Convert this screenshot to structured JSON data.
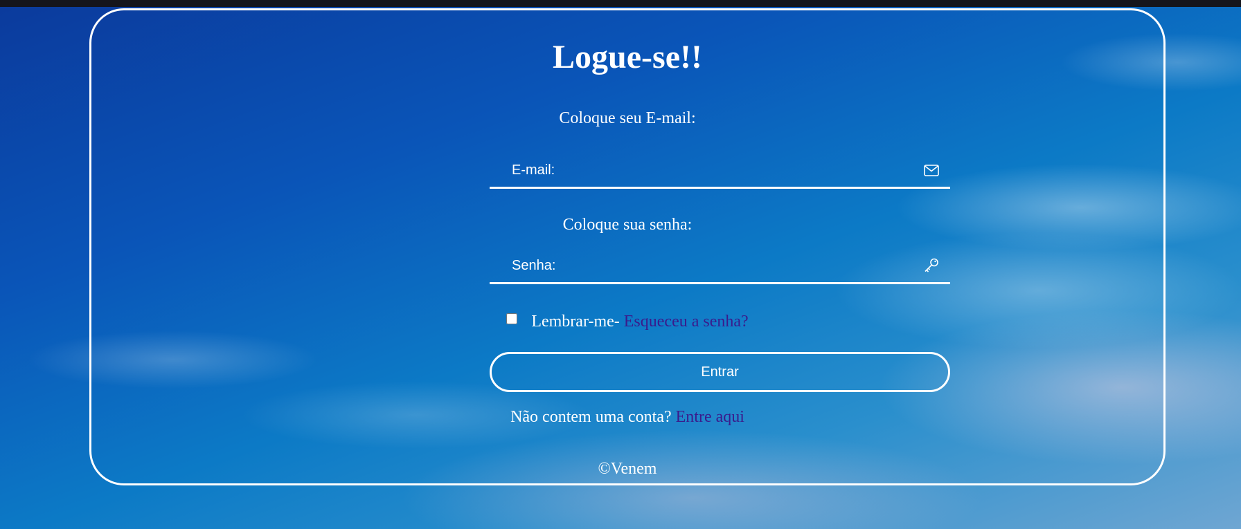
{
  "login": {
    "title": "Logue-se!!",
    "email_label": "Coloque seu E-mail:",
    "email_placeholder": "E-mail:",
    "email_value": "",
    "email_icon": "envelope-icon",
    "password_label": "Coloque sua senha:",
    "password_placeholder": "Senha:",
    "password_value": "",
    "password_icon": "key-icon",
    "remember_label": "Lembrar-me-",
    "remember_checked": false,
    "forgot_link": "Esqueceu a senha?",
    "submit_label": "Entrar",
    "signup_prompt": "Não contem uma conta?",
    "signup_link": "Entre aqui"
  },
  "footer": {
    "copyright": "©Venem"
  },
  "colors": {
    "text": "#ffffff",
    "link": "#3a1b8c",
    "border": "#ffffff",
    "topbar": "#15151c"
  }
}
